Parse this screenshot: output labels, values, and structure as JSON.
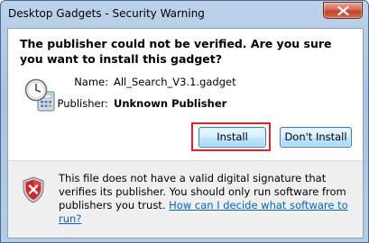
{
  "window": {
    "title": "Desktop Gadgets - Security Warning",
    "close_icon": "close-icon"
  },
  "main": {
    "headline": "The publisher could not be verified. Are you sure you want to install this gadget?",
    "icon": "gadget-clock-calculator-icon",
    "fields": {
      "name_label": "Name:",
      "name_value": "All_Search_V3.1.gadget",
      "publisher_label": "Publisher:",
      "publisher_value": "Unknown Publisher"
    },
    "buttons": {
      "install_label": "Install",
      "dont_install_label": "Don't Install"
    },
    "highlight_color": "#e2232a"
  },
  "footer": {
    "icon": "security-shield-icon",
    "warning_text": "This file does not have a valid digital signature that verifies its publisher. You should only run software from publishers you trust.",
    "help_link": "How can I decide what software to run?"
  }
}
